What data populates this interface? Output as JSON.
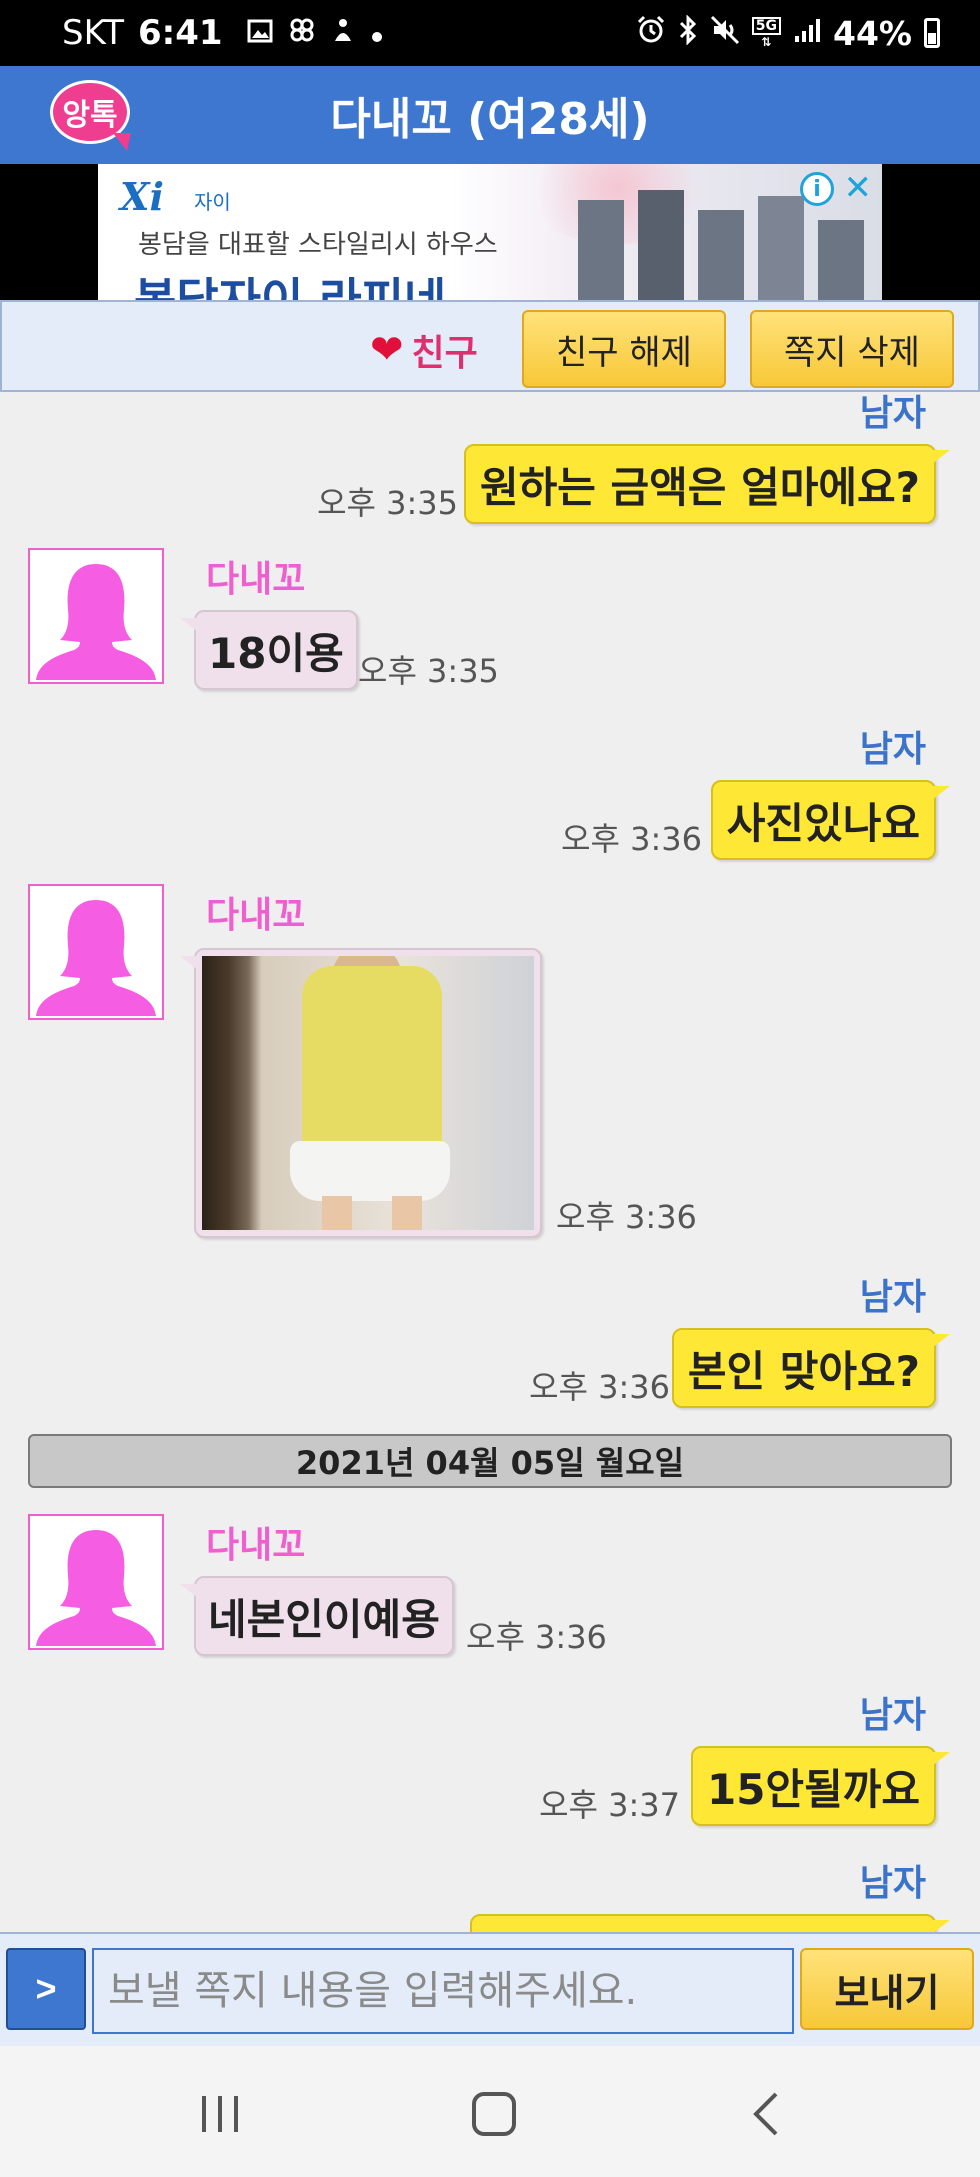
{
  "status_bar": {
    "carrier": "SKT",
    "time": "6:41",
    "network": "5G",
    "battery": "44%",
    "icons_left": [
      "gallery-icon",
      "pinwheel-icon",
      "person-icon",
      "dot-icon"
    ],
    "icons_right": [
      "alarm-icon",
      "bluetooth-icon",
      "mute-icon",
      "network-icon",
      "signal-icon",
      "battery-icon"
    ]
  },
  "app": {
    "logo_text": "앙톡",
    "title": "다내꼬 (여28세)"
  },
  "ad": {
    "brand_logo": "Xi",
    "brand_name": "자이",
    "subtitle": "봉담을 대표할 스타일리시 하우스",
    "headline": "봉담자이 라피네",
    "info_label": "i",
    "close_label": "✕"
  },
  "actions": {
    "friend_label": "친구",
    "unfriend_label": "친구 해제",
    "delete_label": "쪽지 삭제"
  },
  "messages": [
    {
      "from": "남자",
      "side": "right",
      "text": "원하는 금액은 얼마에요?",
      "time": "오후 3:35"
    },
    {
      "from": "다내꼬",
      "side": "left",
      "text": "18이용",
      "time": "오후 3:35"
    },
    {
      "from": "남자",
      "side": "right",
      "text": "사진있나요",
      "time": "오후 3:36"
    },
    {
      "from": "다내꼬",
      "side": "left",
      "type": "photo",
      "time": "오후 3:36"
    },
    {
      "from": "남자",
      "side": "right",
      "text": "본인 맞아요?",
      "time": "오후 3:36"
    },
    {
      "type": "date",
      "text": "2021년 04월 05일 월요일"
    },
    {
      "from": "다내꼬",
      "side": "left",
      "text": "네본인이예용",
      "time": "오후 3:36"
    },
    {
      "from": "남자",
      "side": "right",
      "text": "15안될까요",
      "time": "오후 3:37"
    },
    {
      "from": "남자",
      "side": "right",
      "text": "",
      "time": ""
    }
  ],
  "input": {
    "arrow_label": ">",
    "placeholder": "보낼 쪽지 내용을 입력해주세요.",
    "value": "",
    "send_label": "보내기"
  },
  "colors": {
    "header_blue": "#3d77cf",
    "male_bubble": "#ffe735",
    "female_bubble": "#efe0ec",
    "female_name": "#ef5fd0",
    "male_name": "#3a73c9"
  }
}
